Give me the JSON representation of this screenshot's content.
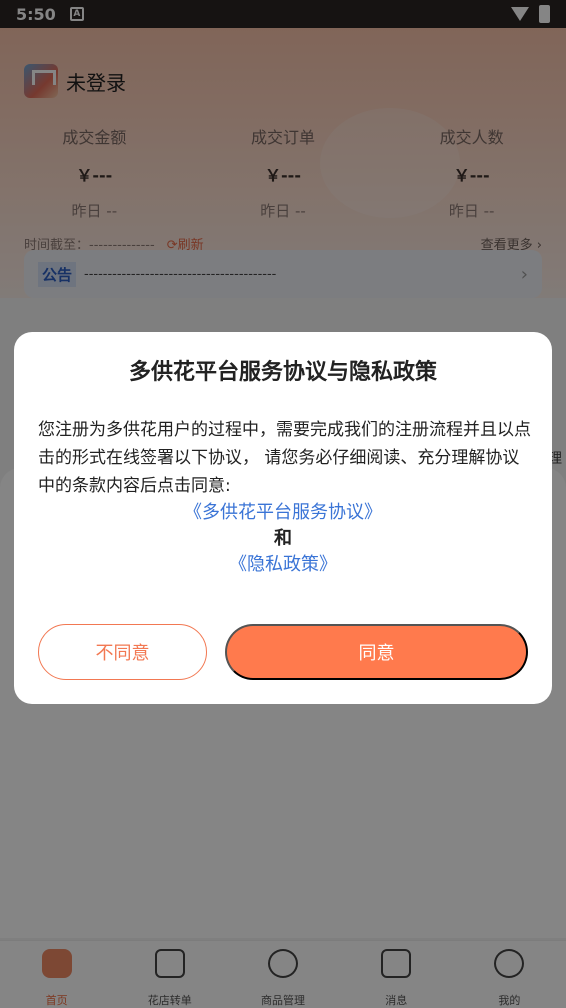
{
  "status_bar": {
    "time": "5:50",
    "a_icon_label": "A"
  },
  "user": {
    "name": "未登录"
  },
  "stats": [
    {
      "label": "成交金额",
      "value": "￥---",
      "yesterday": "昨日 --"
    },
    {
      "label": "成交订单",
      "value": "￥---",
      "yesterday": "昨日 --"
    },
    {
      "label": "成交人数",
      "value": "￥---",
      "yesterday": "昨日 --"
    }
  ],
  "time_row": {
    "label": "时间截至：--------------",
    "refresh": "刷新",
    "more": "查看更多"
  },
  "notice": {
    "tag": "公告",
    "text": "-----------------------------------------",
    "chevron": "›"
  },
  "side_text": "理",
  "tabbar": [
    {
      "label": "首页",
      "icon": "home-icon",
      "active": true
    },
    {
      "label": "花店转单",
      "icon": "document-icon",
      "active": false
    },
    {
      "label": "商品管理",
      "icon": "flower-icon",
      "active": false
    },
    {
      "label": "消息",
      "icon": "message-icon",
      "active": false
    },
    {
      "label": "我的",
      "icon": "face-icon",
      "active": false
    }
  ],
  "dialog": {
    "title": "多供花平台服务协议与隐私政策",
    "body": "您注册为多供花用户的过程中，需要完成我们的注册流程并且以点击的形式在线签署以下协议， 请您务必仔细阅读、充分理解协议中的条款内容后点击同意:",
    "link_service": "《多供花平台服务协议》",
    "and_text": "和",
    "link_privacy": "《隐私政策》",
    "disagree_label": "不同意",
    "agree_label": "同意"
  },
  "colors": {
    "accent": "#ff7a4d",
    "link": "#3a74d6",
    "notice_tag": "#2d5fc2"
  }
}
